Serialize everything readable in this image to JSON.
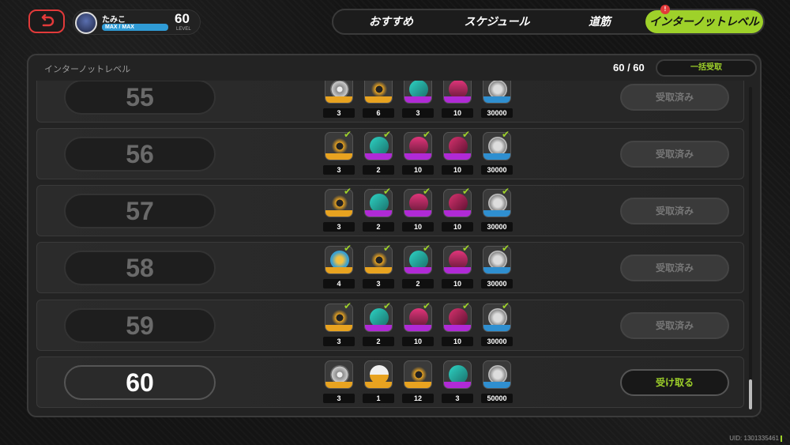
{
  "player": {
    "name": "たみこ",
    "exp_label": "MAX / MAX",
    "level": "60",
    "level_caption": "LEVEL"
  },
  "tabs": [
    {
      "label": "おすすめ",
      "active": false
    },
    {
      "label": "スケジュール",
      "active": false
    },
    {
      "label": "道筋",
      "active": false
    },
    {
      "label": "インターノットレベル",
      "active": true
    }
  ],
  "tab_badge": "!",
  "panel": {
    "title": "インターノットレベル",
    "count": "60 / 60",
    "claim_all_label": "一括受取"
  },
  "rows": [
    {
      "level": "55",
      "status": "受取済み",
      "rewards": [
        {
          "icon": "disc-icon",
          "qty": "3",
          "rarity": "gold"
        },
        {
          "icon": "core-icon",
          "qty": "6",
          "rarity": "gold"
        },
        {
          "icon": "chip-icon",
          "qty": "3",
          "rarity": "purple"
        },
        {
          "icon": "car-icon",
          "qty": "10",
          "rarity": "purple"
        },
        {
          "icon": "dennis-coin-icon",
          "qty": "30000",
          "rarity": "blue"
        }
      ]
    },
    {
      "level": "56",
      "status": "受取済み",
      "rewards": [
        {
          "icon": "core-icon",
          "qty": "3",
          "rarity": "gold"
        },
        {
          "icon": "chip-icon",
          "qty": "2",
          "rarity": "purple"
        },
        {
          "icon": "car-icon",
          "qty": "10",
          "rarity": "purple"
        },
        {
          "icon": "card-icon",
          "qty": "10",
          "rarity": "purple"
        },
        {
          "icon": "dennis-coin-icon",
          "qty": "30000",
          "rarity": "blue"
        }
      ]
    },
    {
      "level": "57",
      "status": "受取済み",
      "rewards": [
        {
          "icon": "core-icon",
          "qty": "3",
          "rarity": "gold"
        },
        {
          "icon": "chip-icon",
          "qty": "2",
          "rarity": "purple"
        },
        {
          "icon": "car-icon",
          "qty": "10",
          "rarity": "purple"
        },
        {
          "icon": "card-icon",
          "qty": "10",
          "rarity": "purple"
        },
        {
          "icon": "dennis-coin-icon",
          "qty": "30000",
          "rarity": "blue"
        }
      ]
    },
    {
      "level": "58",
      "status": "受取済み",
      "rewards": [
        {
          "icon": "energy-icon",
          "qty": "4",
          "rarity": "gold"
        },
        {
          "icon": "core-icon",
          "qty": "3",
          "rarity": "gold"
        },
        {
          "icon": "chip-icon",
          "qty": "2",
          "rarity": "purple"
        },
        {
          "icon": "car-icon",
          "qty": "10",
          "rarity": "purple"
        },
        {
          "icon": "dennis-coin-icon",
          "qty": "30000",
          "rarity": "blue"
        }
      ]
    },
    {
      "level": "59",
      "status": "受取済み",
      "rewards": [
        {
          "icon": "core-icon",
          "qty": "3",
          "rarity": "gold"
        },
        {
          "icon": "chip-icon",
          "qty": "2",
          "rarity": "purple"
        },
        {
          "icon": "car-icon",
          "qty": "10",
          "rarity": "purple"
        },
        {
          "icon": "card-icon",
          "qty": "10",
          "rarity": "purple"
        },
        {
          "icon": "dennis-coin-icon",
          "qty": "30000",
          "rarity": "blue"
        }
      ]
    },
    {
      "level": "60",
      "status": "受け取る",
      "current": true,
      "rewards": [
        {
          "icon": "disc-icon",
          "qty": "3",
          "rarity": "gold"
        },
        {
          "icon": "tape-icon",
          "qty": "1",
          "rarity": "gold"
        },
        {
          "icon": "core-icon",
          "qty": "12",
          "rarity": "gold"
        },
        {
          "icon": "chip-icon",
          "qty": "3",
          "rarity": "purple"
        },
        {
          "icon": "dennis-coin-icon",
          "qty": "50000",
          "rarity": "blue"
        }
      ]
    }
  ],
  "uid": "UID: 1301335461",
  "colors": {
    "accent": "#9ed12a",
    "alert": "#e23a3a",
    "gold": "#e8a320",
    "purple": "#b02ad6",
    "blue": "#2f8fd0"
  }
}
